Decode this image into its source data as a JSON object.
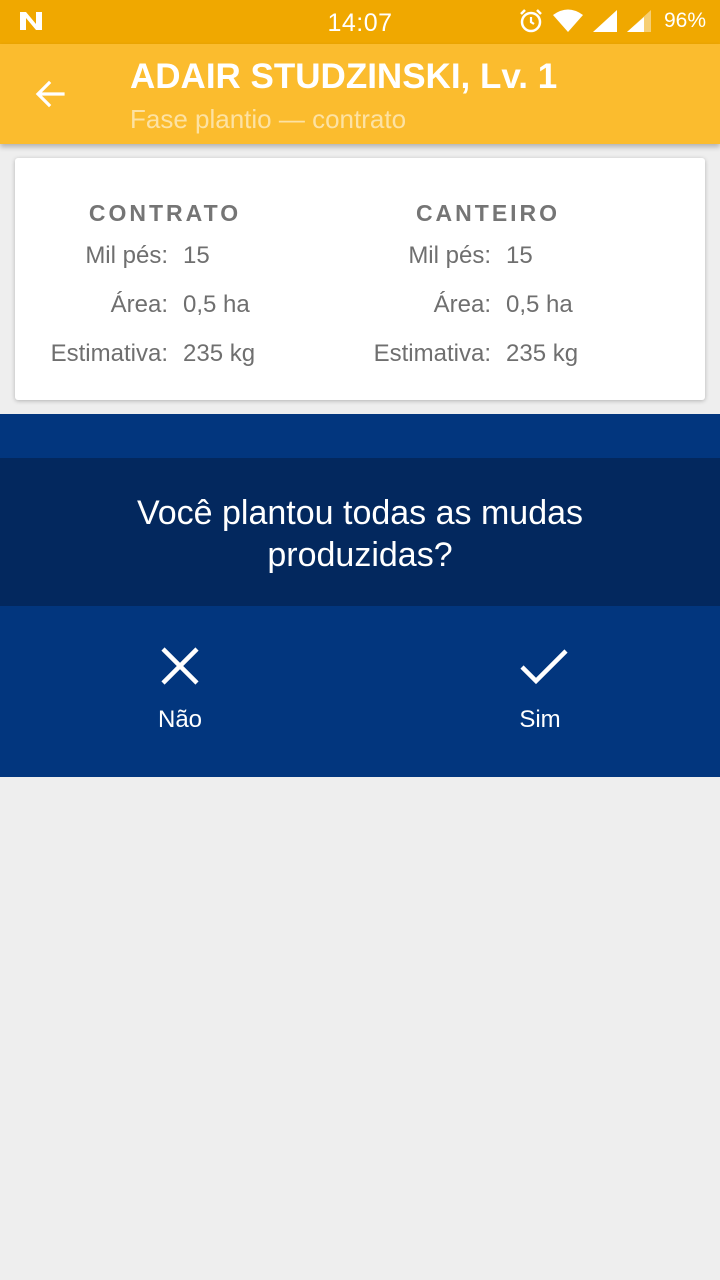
{
  "status_bar": {
    "time": "14:07",
    "battery": "96%",
    "icons": [
      "n-notification-icon",
      "alarm-icon",
      "wifi-icon",
      "signal-icon",
      "signal-icon-2"
    ]
  },
  "app_bar": {
    "title": "ADAIR STUDZINSKI, Lv. 1",
    "subtitle": "Fase plantio — contrato",
    "back_icon": "arrow-back-icon"
  },
  "summary": {
    "contrato": {
      "header": "CONTRATO",
      "rows": [
        {
          "label": "Mil pés:",
          "value": "15"
        },
        {
          "label": "Área:",
          "value": "0,5 ha"
        },
        {
          "label": "Estimativa:",
          "value": "235 kg"
        }
      ]
    },
    "canteiro": {
      "header": "CANTEIRO",
      "rows": [
        {
          "label": "Mil pés:",
          "value": "15"
        },
        {
          "label": "Área:",
          "value": "0,5 ha"
        },
        {
          "label": "Estimativa:",
          "value": "235 kg"
        }
      ]
    }
  },
  "question": {
    "text": "Você plantou todas as mudas produzidas?",
    "no_label": "Não",
    "yes_label": "Sim"
  },
  "colors": {
    "status_bar": "#f0a800",
    "app_bar": "#fbbc2e",
    "question_bg": "#02367e",
    "question_band": "#03285e",
    "page_bg": "#eeeeee"
  }
}
